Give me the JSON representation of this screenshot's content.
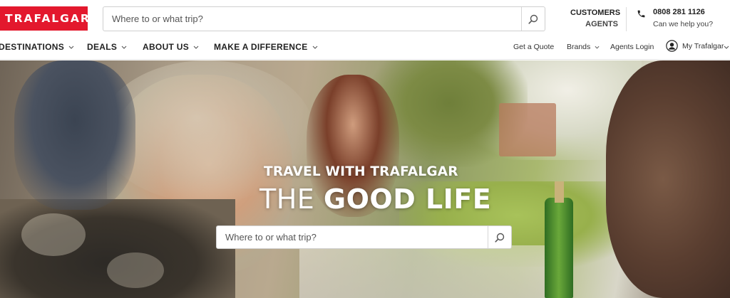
{
  "header": {
    "logo_text": "TRAFALGAR",
    "search_placeholder": "Where to or what trip?",
    "customers_label": "CUSTOMERS",
    "agents_label": "AGENTS",
    "phone_number": "0808 281 1126",
    "help_text": "Can we help you?"
  },
  "nav": {
    "items": [
      {
        "label": "DESTINATIONS"
      },
      {
        "label": "DEALS"
      },
      {
        "label": "ABOUT US"
      },
      {
        "label": "MAKE A DIFFERENCE"
      }
    ],
    "right": {
      "get_quote": "Get a Quote",
      "brands": "Brands",
      "agents_login": "Agents Login",
      "my_trafalgar": "My Trafalgar"
    }
  },
  "hero": {
    "title_small": "TRAVEL WITH TRAFALGAR",
    "title_light": "THE",
    "title_bold": "GOOD LIFE",
    "search_placeholder": "Where to or what trip?"
  },
  "colors": {
    "brand_red": "#e3182d",
    "text_dark": "#222222"
  },
  "icons": [
    "search-icon",
    "phone-icon",
    "chevron-down-icon",
    "user-icon"
  ]
}
